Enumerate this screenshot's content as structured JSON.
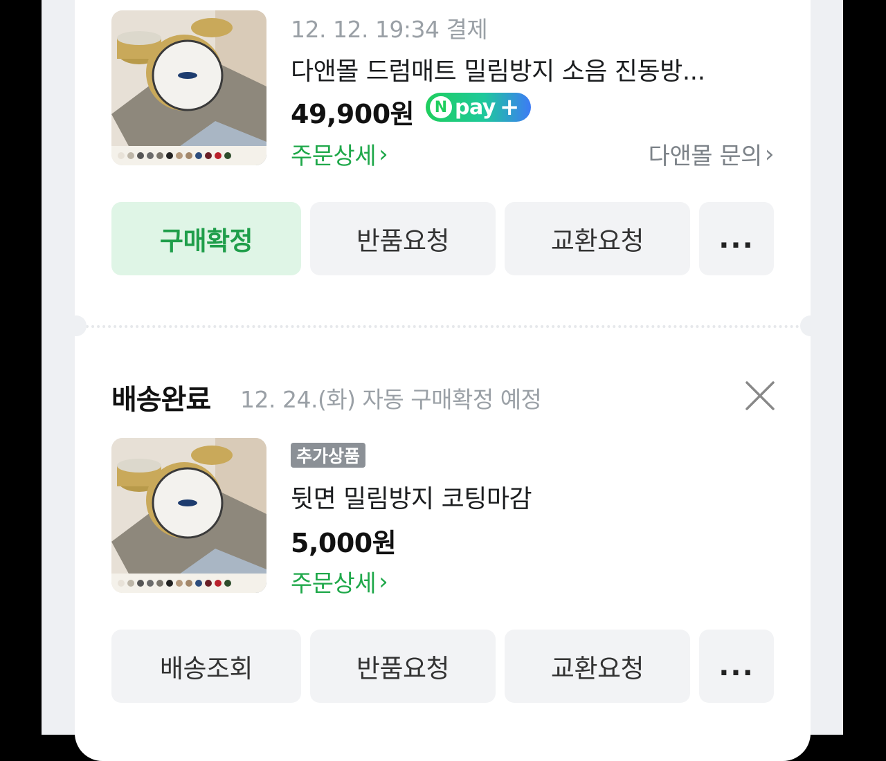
{
  "order1": {
    "date": "12. 12. 19:34 결제",
    "title": "다앤몰 드럼매트 밀림방지 소음 진동방...",
    "price": "49,900원",
    "npay_n": "N",
    "npay_label": "pay",
    "npay_plus": "+",
    "detail_link": "주문상세",
    "inquiry_link": "다앤몰 문의",
    "buttons": [
      "구매확정",
      "반품요청",
      "교환요청",
      "..."
    ]
  },
  "order2": {
    "status": "배송완료",
    "status_sub": "12. 24.(화) 자동 구매확정 예정",
    "tag": "추가상품",
    "title": "뒷면 밀림방지 코팅마감",
    "price": "5,000원",
    "detail_link": "주문상세",
    "buttons": [
      "배송조회",
      "반품요청",
      "교환요청",
      "..."
    ]
  },
  "icons": {
    "chevron": "chevron-right-icon",
    "close": "close-icon",
    "more": "more-horizontal-icon"
  },
  "colors": {
    "accent_green": "#1fa84a",
    "confirm_button_bg": "#dff5e6"
  }
}
